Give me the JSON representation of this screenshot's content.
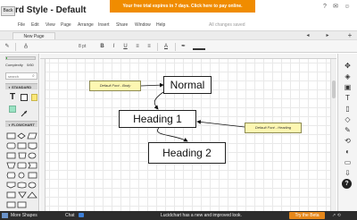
{
  "header": {
    "back_label": "Back",
    "doc_title": "rd Style - Default",
    "trial_banner": "Your free trial expires in 7 days. Click here to pay online.",
    "icons": [
      "help-icon",
      "chat-icon",
      "account-icon"
    ]
  },
  "menubar": {
    "items": [
      "File",
      "Edit",
      "View",
      "Page",
      "Arrange",
      "Insert",
      "Share",
      "Window",
      "Help"
    ],
    "save_status": "All changes saved"
  },
  "pages": {
    "tab_label": "New Page",
    "nav_prev": "◂",
    "nav_next": "▸",
    "add_label": "+"
  },
  "toolbar": {
    "font_size": "8 pt",
    "bold": "B",
    "italic": "I",
    "underline": "U",
    "text_color_label": "A"
  },
  "left_panel": {
    "complexity_label": "Complexity",
    "complexity_count": "0/60",
    "complexity_fraction": 0.02,
    "search_placeholder": "search",
    "sections": [
      {
        "label": "STANDARD"
      },
      {
        "label": "FLOWCHART"
      }
    ],
    "standard_text_tool": "T"
  },
  "canvas": {
    "nodes": {
      "normal": "Normal",
      "heading1": "Heading 1",
      "heading2": "Heading 2"
    },
    "notes": {
      "body": "Default Font - Body",
      "heading": "Default Font - Heading"
    }
  },
  "right_rail": {
    "help_label": "?"
  },
  "bottom_bar": {
    "more_shapes": "More Shapes",
    "chat": "Chat",
    "message": "Lucidchart has a new and improved look.",
    "beta_button": "Try the Beta",
    "arrows": "↗ ⟲"
  },
  "colors": {
    "banner": "#f08c00",
    "note_fill": "#fdf7b2",
    "beta_button": "#e6871a",
    "bottom_bar": "#2d2d2d"
  }
}
